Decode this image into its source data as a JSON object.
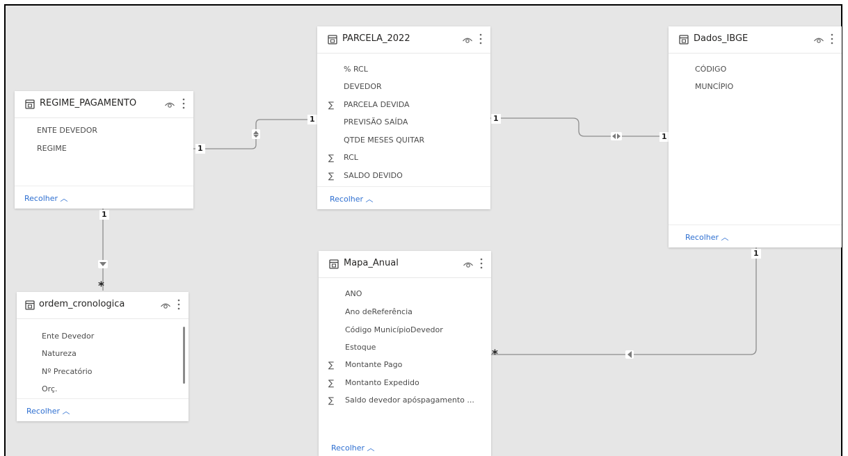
{
  "tables": {
    "regime": {
      "title": "REGIME_PAGAMENTO",
      "fields": [
        {
          "label": "ENTE DEVEDOR",
          "sigma": ""
        },
        {
          "label": "REGIME",
          "sigma": ""
        }
      ],
      "collapse": "Recolher"
    },
    "parcela": {
      "title": "PARCELA_2022",
      "fields": [
        {
          "label": "% RCL",
          "sigma": ""
        },
        {
          "label": "DEVEDOR",
          "sigma": ""
        },
        {
          "label": "PARCELA DEVIDA",
          "sigma": "∑"
        },
        {
          "label": "PREVISÃO SAÍDA",
          "sigma": ""
        },
        {
          "label": "QTDE MESES QUITAR",
          "sigma": ""
        },
        {
          "label": "RCL",
          "sigma": "∑"
        },
        {
          "label": "SALDO DEVIDO",
          "sigma": "∑"
        }
      ],
      "collapse": "Recolher"
    },
    "ibge": {
      "title": "Dados_IBGE",
      "fields": [
        {
          "label": "CÓDIGO",
          "sigma": ""
        },
        {
          "label": "MUNCÍPIO",
          "sigma": ""
        }
      ],
      "collapse": "Recolher"
    },
    "ordem": {
      "title": "ordem_cronologica",
      "fields": [
        {
          "label": "Ente Devedor",
          "sigma": ""
        },
        {
          "label": "Natureza",
          "sigma": ""
        },
        {
          "label": "Nº Precatório",
          "sigma": ""
        },
        {
          "label": "Orç.",
          "sigma": ""
        }
      ],
      "collapse": "Recolher"
    },
    "mapa": {
      "title": "Mapa_Anual",
      "fields": [
        {
          "label": "ANO",
          "sigma": ""
        },
        {
          "label": "Ano deReferência",
          "sigma": ""
        },
        {
          "label": "Código MunicípioDevedor",
          "sigma": ""
        },
        {
          "label": "Estoque",
          "sigma": ""
        },
        {
          "label": "Montante Pago",
          "sigma": "∑"
        },
        {
          "label": "Montanto Expedido",
          "sigma": "∑"
        },
        {
          "label": "Saldo devedor apóspagamento ...",
          "sigma": "∑"
        }
      ],
      "collapse": "Recolher"
    }
  },
  "relationships": {
    "regime_parcela": {
      "from": "1",
      "to": "1"
    },
    "parcela_ibge": {
      "from": "1",
      "to": "1"
    },
    "regime_ordem": {
      "from": "1",
      "to": "*"
    },
    "ibge_mapa": {
      "from": "1",
      "to": "*"
    }
  },
  "icons": {
    "table": "table-icon",
    "visibility": "eye-icon",
    "more": "more-options-icon",
    "collapse": "chevron-up-icon"
  },
  "colors": {
    "canvas": "#e6e6e6",
    "card": "#ffffff",
    "link": "#2e6fd1",
    "line": "#8c8c8c"
  }
}
